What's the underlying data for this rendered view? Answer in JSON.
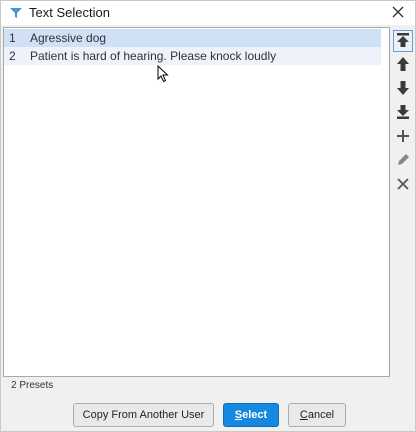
{
  "window": {
    "title": "Text Selection",
    "app_icon": "filter-funnel-icon",
    "close_icon": "close-icon"
  },
  "list": {
    "rows": [
      {
        "num": "1",
        "text": "Agressive dog",
        "selected": true
      },
      {
        "num": "2",
        "text": "Patient is hard of hearing. Please knock loudly",
        "selected": false
      }
    ]
  },
  "toolbar": {
    "items": [
      "move-to-top-icon",
      "move-up-icon",
      "move-down-icon",
      "move-to-bottom-icon",
      "add-icon",
      "edit-pencil-icon",
      "delete-x-icon"
    ]
  },
  "status": {
    "text": "2 Presets"
  },
  "buttons": {
    "copy": "Copy From Another User",
    "select_first": "S",
    "select_rest": "elect",
    "cancel_first": "C",
    "cancel_rest": "ancel"
  },
  "colors": {
    "accent": "#1588e0",
    "selected_row": "#cfe0f7",
    "alt_row": "#edf2fb"
  }
}
